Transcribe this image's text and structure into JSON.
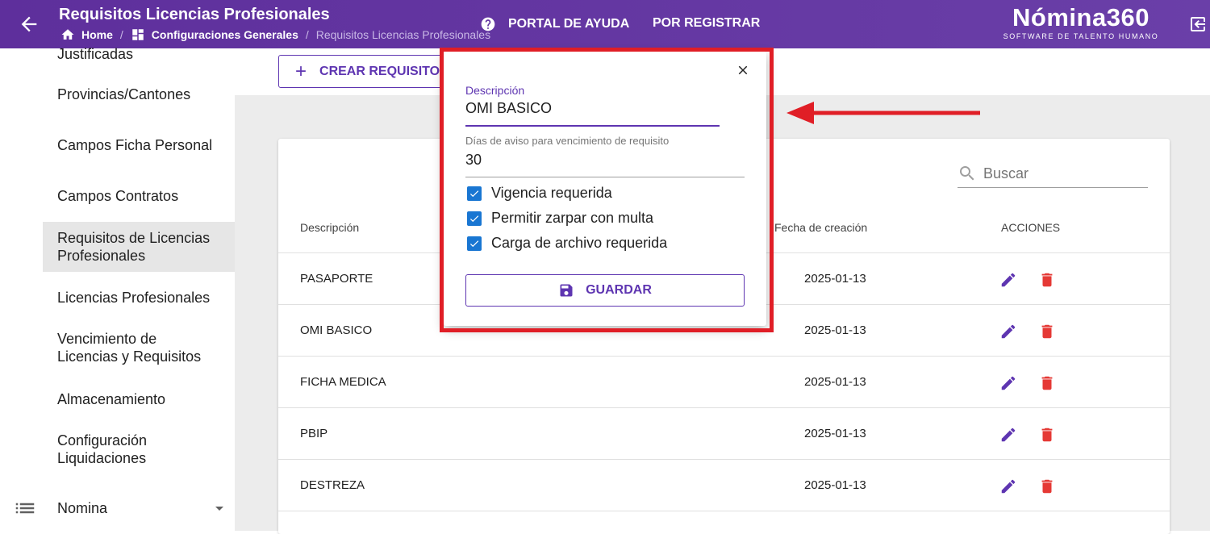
{
  "header": {
    "title": "Requisitos Licencias Profesionales",
    "breadcrumb": [
      "Home",
      "Configuraciones Generales",
      "Requisitos Licencias Profesionales"
    ],
    "nav": [
      "PORTAL DE AYUDA",
      "POR REGISTRAR"
    ],
    "brand_name": "Nómina360",
    "brand_sub": "SOFTWARE DE TALENTO HUMANO",
    "accent_color": "#5e2f9c"
  },
  "sidebar": {
    "items": [
      {
        "label": "Justificadas"
      },
      {
        "label": "Provincias/Cantones"
      },
      {
        "label": "Campos Ficha Personal"
      },
      {
        "label": "Campos Contratos"
      },
      {
        "label": "Requisitos de Licencias Profesionales",
        "active": true
      },
      {
        "label": "Licencias Profesionales"
      },
      {
        "label": "Vencimiento de Licencias y Requisitos"
      },
      {
        "label": "Almacenamiento"
      },
      {
        "label": "Configuración Liquidaciones"
      }
    ],
    "group": {
      "label": "Nomina",
      "icon": "list-icon"
    }
  },
  "main": {
    "create_button": "CREAR REQUISITO",
    "search_placeholder": "Buscar",
    "table": {
      "columns": [
        "Descripción",
        "Fecha de creación",
        "ACCIONES"
      ],
      "rows": [
        {
          "descripcion": "PASAPORTE",
          "fecha": "2025-01-13"
        },
        {
          "descripcion": "OMI BASICO",
          "fecha": "2025-01-13"
        },
        {
          "descripcion": "FICHA MEDICA",
          "fecha": "2025-01-13"
        },
        {
          "descripcion": "PBIP",
          "fecha": "2025-01-13"
        },
        {
          "descripcion": "DESTREZA",
          "fecha": "2025-01-13"
        }
      ]
    }
  },
  "dialog": {
    "description_label": "Descripción",
    "description_value": "OMI BASICO",
    "days_label": "Días de aviso para vencimiento de requisito",
    "days_value": "30",
    "checkboxes": [
      {
        "label": "Vigencia requerida",
        "checked": true
      },
      {
        "label": "Permitir zarpar con multa",
        "checked": true
      },
      {
        "label": "Carga de archivo requerida",
        "checked": true
      }
    ],
    "save_button": "GUARDAR",
    "highlight_color": "#e01e26"
  }
}
